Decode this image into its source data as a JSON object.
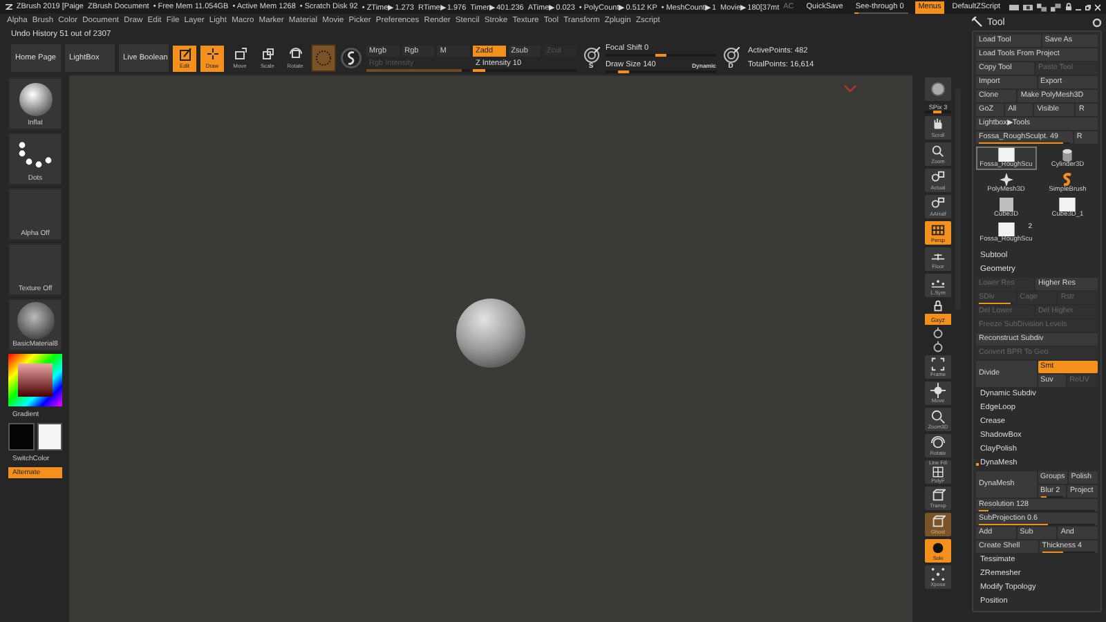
{
  "title_bar": {
    "title": "ZBrush 2019 [Paige",
    "document": "ZBrush Document",
    "stats": [
      "• Free Mem 11.054GB",
      "• Active Mem 1268",
      "• Scratch Disk 92",
      "• ZTime▶1.273",
      "RTime▶1.976",
      "Timer▶401.236",
      "ATime▶0.023",
      "• PolyCount▶0.512 KP",
      "• MeshCount▶1",
      "Movie▶180[37mt"
    ],
    "ac": "AC",
    "quicksave": "QuickSave",
    "see_through": {
      "label": "See-through",
      "value": "0",
      "level": 0.05
    },
    "menus": {
      "label": "Menus",
      "on": true
    },
    "script": "DefaultZScript"
  },
  "menu_bar": [
    "Alpha",
    "Brush",
    "Color",
    "Document",
    "Draw",
    "Edit",
    "File",
    "Layer",
    "Light",
    "Macro",
    "Marker",
    "Material",
    "Movie",
    "Picker",
    "Preferences",
    "Render",
    "Stencil",
    "Stroke",
    "Texture",
    "Tool",
    "Transform",
    "Zplugin",
    "Zscript"
  ],
  "undo_history": "Undo History 51 out of 2307",
  "toolbar": {
    "nav": [
      "Home Page",
      "LightBox",
      "Live Boolean"
    ],
    "modes": [
      {
        "kind": "edit",
        "label": "Edit",
        "selected": true
      },
      {
        "kind": "draw",
        "label": "Draw",
        "selected": true
      },
      {
        "kind": "move",
        "label": "Move",
        "selected": false
      },
      {
        "kind": "scale",
        "label": "Scale",
        "selected": false
      },
      {
        "kind": "rotate",
        "label": "Rotate",
        "selected": false
      }
    ],
    "channels": [
      {
        "label": "Mrgb",
        "selected": false,
        "disabled": false
      },
      {
        "label": "Rgb",
        "selected": false,
        "disabled": false
      },
      {
        "label": "M",
        "selected": false,
        "disabled": false
      },
      {
        "label": "Zadd",
        "selected": true,
        "disabled": false
      },
      {
        "label": "Zsub",
        "selected": false,
        "disabled": false
      },
      {
        "label": "Zcut",
        "selected": false,
        "disabled": true
      }
    ],
    "intensity": [
      {
        "label": "Rgb Intensity",
        "level": 0.92,
        "disabled": true
      },
      {
        "label": "Z Intensity",
        "value": "10",
        "level": 0.12,
        "disabled": false
      }
    ],
    "focal_icon": "S",
    "size_icon": "D",
    "brush_sliders": [
      {
        "label": "Focal Shift",
        "value": "0",
        "level": 0.5
      },
      {
        "label": "Draw Size",
        "value": "140",
        "level": 0.16,
        "tag": "Dynamic"
      }
    ],
    "points": [
      "ActivePoints: 482",
      "TotalPoints: 16,614"
    ]
  },
  "left_shelf": {
    "tiles": [
      {
        "kind": "brush",
        "label": "Inflat"
      },
      {
        "kind": "stroke",
        "label": "Dots"
      },
      {
        "kind": "alpha",
        "label": "Alpha Off"
      },
      {
        "kind": "texture",
        "label": "Texture Off"
      },
      {
        "kind": "material",
        "label": "BasicMaterial8"
      }
    ],
    "gradient": "Gradient",
    "swatches": [
      {
        "color": "#050505"
      },
      {
        "color": "#f5f5f5"
      }
    ],
    "switch_color": "SwitchColor",
    "alternate": {
      "label": "Alternate",
      "on": true
    }
  },
  "right_shelf": [
    {
      "kind": "render",
      "selected": false,
      "muted": false
    },
    {
      "kind": "slider",
      "label": "SPix 3",
      "level": 0.45
    },
    {
      "kind": "scroll",
      "label": "Scroll",
      "selected": false,
      "muted": false
    },
    {
      "kind": "zoom",
      "label": "Zoom",
      "selected": false,
      "muted": false
    },
    {
      "kind": "actual",
      "label": "Actual",
      "selected": false,
      "muted": false
    },
    {
      "kind": "half",
      "label": "AAHalf",
      "selected": false,
      "muted": false
    },
    {
      "kind": "persp",
      "label": "Persp",
      "selected": true,
      "muted": false
    },
    {
      "kind": "floor",
      "label": "Floor",
      "selected": false,
      "muted": false
    },
    {
      "kind": "sym",
      "label": "L.Sym",
      "selected": false,
      "muted": false
    },
    {
      "kind": "lock",
      "selected": false,
      "muted": false
    },
    {
      "kind": "xyz",
      "label": "Gxyz",
      "selected": true,
      "muted": false
    },
    {
      "kind": "axis",
      "selected": false,
      "muted": false
    },
    {
      "kind": "axis",
      "selected": false,
      "muted": false
    },
    {
      "kind": "frame",
      "label": "Frame",
      "selected": false,
      "muted": false
    },
    {
      "kind": "move",
      "label": "Move",
      "selected": false,
      "muted": false
    },
    {
      "kind": "zoom3d",
      "label": "Zoom3D",
      "selected": false,
      "muted": false
    },
    {
      "kind": "rotate",
      "label": "Rotate",
      "selected": false,
      "muted": false
    },
    {
      "kind": "polyf",
      "caption": "Line Fill",
      "label": "PolyF",
      "selected": false,
      "muted": false
    },
    {
      "kind": "transp",
      "label": "Transp",
      "selected": false,
      "muted": false
    },
    {
      "kind": "ghost",
      "label": "Ghost",
      "selected": false,
      "muted": true
    },
    {
      "kind": "solo",
      "label": "Solo",
      "selected": true,
      "muted": false
    },
    {
      "kind": "xpose",
      "label": "Xpose",
      "selected": false,
      "muted": false
    }
  ],
  "tool_panel": {
    "title": "Tool",
    "rows": [
      {
        "kind": "buttons",
        "cells": [
          {
            "label": "Load Tool",
            "selected": false,
            "disabled": false
          },
          {
            "label": "Save As",
            "selected": false,
            "disabled": false
          }
        ]
      },
      {
        "kind": "buttons",
        "cells": [
          {
            "label": "Load Tools From Project",
            "selected": false,
            "disabled": false
          }
        ]
      },
      {
        "kind": "buttons",
        "cells": [
          {
            "label": "Copy Tool",
            "selected": false,
            "disabled": false
          },
          {
            "label": "Paste Tool",
            "selected": false,
            "disabled": true
          }
        ]
      },
      {
        "kind": "buttons",
        "cells": [
          {
            "label": "Import",
            "selected": false,
            "disabled": false
          },
          {
            "label": "Export",
            "selected": false,
            "disabled": false
          }
        ]
      },
      {
        "kind": "buttons",
        "cells": [
          {
            "label": "Clone",
            "selected": false,
            "disabled": false
          },
          {
            "label": "Make PolyMesh3D",
            "selected": false,
            "disabled": false
          }
        ]
      },
      {
        "kind": "buttons",
        "cells": [
          {
            "label": "GoZ",
            "selected": false,
            "disabled": false
          },
          {
            "label": "All",
            "selected": false,
            "disabled": false
          },
          {
            "label": "Visible",
            "selected": false,
            "disabled": false
          },
          {
            "label": "R",
            "selected": false,
            "disabled": false
          }
        ]
      },
      {
        "kind": "buttons",
        "cells": [
          {
            "label": "Lightbox▶Tools",
            "selected": false,
            "disabled": false
          }
        ]
      },
      {
        "kind": "buttons",
        "cells": [
          {
            "label": "Fossa_RoughSculpt. 49",
            "selected": false,
            "disabled": false,
            "level": 0.93
          },
          {
            "label": "R",
            "selected": false,
            "disabled": false
          }
        ]
      },
      {
        "kind": "thumbs",
        "items": [
          {
            "label": "Fossa_RoughScu",
            "kind": "block",
            "selected": true
          },
          {
            "label": "Cylinder3D",
            "kind": "cylinder",
            "selected": false
          },
          {
            "label": "PolyMesh3D",
            "kind": "star",
            "selected": false
          },
          {
            "label": "SimpleBrush",
            "kind": "brush",
            "selected": false
          },
          {
            "label": "Cube3D",
            "kind": "cube",
            "selected": false
          },
          {
            "label": "Cube3D_1",
            "kind": "block",
            "selected": false
          },
          {
            "label": "Fossa_RoughScu",
            "kind": "block",
            "selected": false,
            "count": "2"
          }
        ]
      },
      {
        "kind": "header",
        "label": "Subtool"
      },
      {
        "kind": "subheader",
        "label": "Geometry"
      },
      {
        "kind": "buttons",
        "cells": [
          {
            "label": "Lower Res",
            "selected": false,
            "disabled": true
          },
          {
            "label": "Higher Res",
            "selected": false,
            "disabled": false
          }
        ]
      },
      {
        "kind": "buttons",
        "cells": [
          {
            "label": "SDiv",
            "selected": false,
            "disabled": true,
            "level": 0.95
          },
          {
            "label": "Cage",
            "selected": false,
            "disabled": true
          },
          {
            "label": "Rstr",
            "selected": false,
            "disabled": true
          }
        ]
      },
      {
        "kind": "buttons",
        "cells": [
          {
            "label": "Del Lower",
            "selected": false,
            "disabled": true
          },
          {
            "label": "Del Higher",
            "selected": false,
            "disabled": true
          }
        ]
      },
      {
        "kind": "buttons",
        "cells": [
          {
            "label": "Freeze SubDivision Levels",
            "selected": false,
            "disabled": true
          }
        ]
      },
      {
        "kind": "buttons",
        "cells": [
          {
            "label": "Reconstruct Subdiv",
            "selected": false,
            "disabled": false
          }
        ]
      },
      {
        "kind": "buttons",
        "cells": [
          {
            "label": "Convert BPR To Geo",
            "selected": false,
            "disabled": true
          }
        ]
      },
      {
        "kind": "split",
        "main": {
          "label": "Divide",
          "selected": false,
          "disabled": false
        },
        "rows": [
          [
            {
              "label": "Smt",
              "selected": true,
              "disabled": false
            }
          ],
          [
            {
              "label": "Suv",
              "selected": false,
              "disabled": false
            },
            {
              "label": "ReUV",
              "selected": false,
              "disabled": true
            }
          ]
        ]
      },
      {
        "kind": "item",
        "label": "Dynamic Subdiv",
        "expanded": false
      },
      {
        "kind": "item",
        "label": "EdgeLoop",
        "expanded": false
      },
      {
        "kind": "item",
        "label": "Crease",
        "expanded": false
      },
      {
        "kind": "item",
        "label": "ShadowBox",
        "expanded": false
      },
      {
        "kind": "item",
        "label": "ClayPolish",
        "expanded": false
      },
      {
        "kind": "item",
        "label": "DynaMesh",
        "expanded": true
      },
      {
        "kind": "split",
        "main": {
          "label": "DynaMesh",
          "selected": false,
          "disabled": false
        },
        "rows": [
          [
            {
              "label": "Groups",
              "selected": false,
              "disabled": false
            },
            {
              "label": "Polish",
              "selected": false,
              "disabled": false
            }
          ],
          [
            {
              "label": "Blur 2",
              "selected": false,
              "disabled": false,
              "level": 0.3
            },
            {
              "label": "Project",
              "selected": false,
              "disabled": false
            }
          ]
        ]
      },
      {
        "kind": "buttons",
        "cells": [
          {
            "label": "Resolution 128",
            "selected": false,
            "disabled": false,
            "level": 0.08
          }
        ]
      },
      {
        "kind": "buttons",
        "cells": [
          {
            "label": "SubProjection 0.6",
            "selected": false,
            "disabled": false,
            "level": 0.6
          }
        ]
      },
      {
        "kind": "buttons",
        "cells": [
          {
            "label": "Add",
            "selected": false,
            "disabled": false
          },
          {
            "label": "Sub",
            "selected": false,
            "disabled": false
          },
          {
            "label": "And",
            "selected": false,
            "disabled": false
          }
        ]
      },
      {
        "kind": "buttons",
        "cells": [
          {
            "label": "Create Shell",
            "selected": false,
            "disabled": false
          },
          {
            "label": "Thickness 4",
            "selected": false,
            "disabled": false,
            "level": 0.4
          }
        ]
      },
      {
        "kind": "item",
        "label": "Tessimate",
        "expanded": false
      },
      {
        "kind": "item",
        "label": "ZRemesher",
        "expanded": false
      },
      {
        "kind": "item",
        "label": "Modify Topology",
        "expanded": false
      },
      {
        "kind": "item",
        "label": "Position",
        "expanded": false
      }
    ]
  }
}
